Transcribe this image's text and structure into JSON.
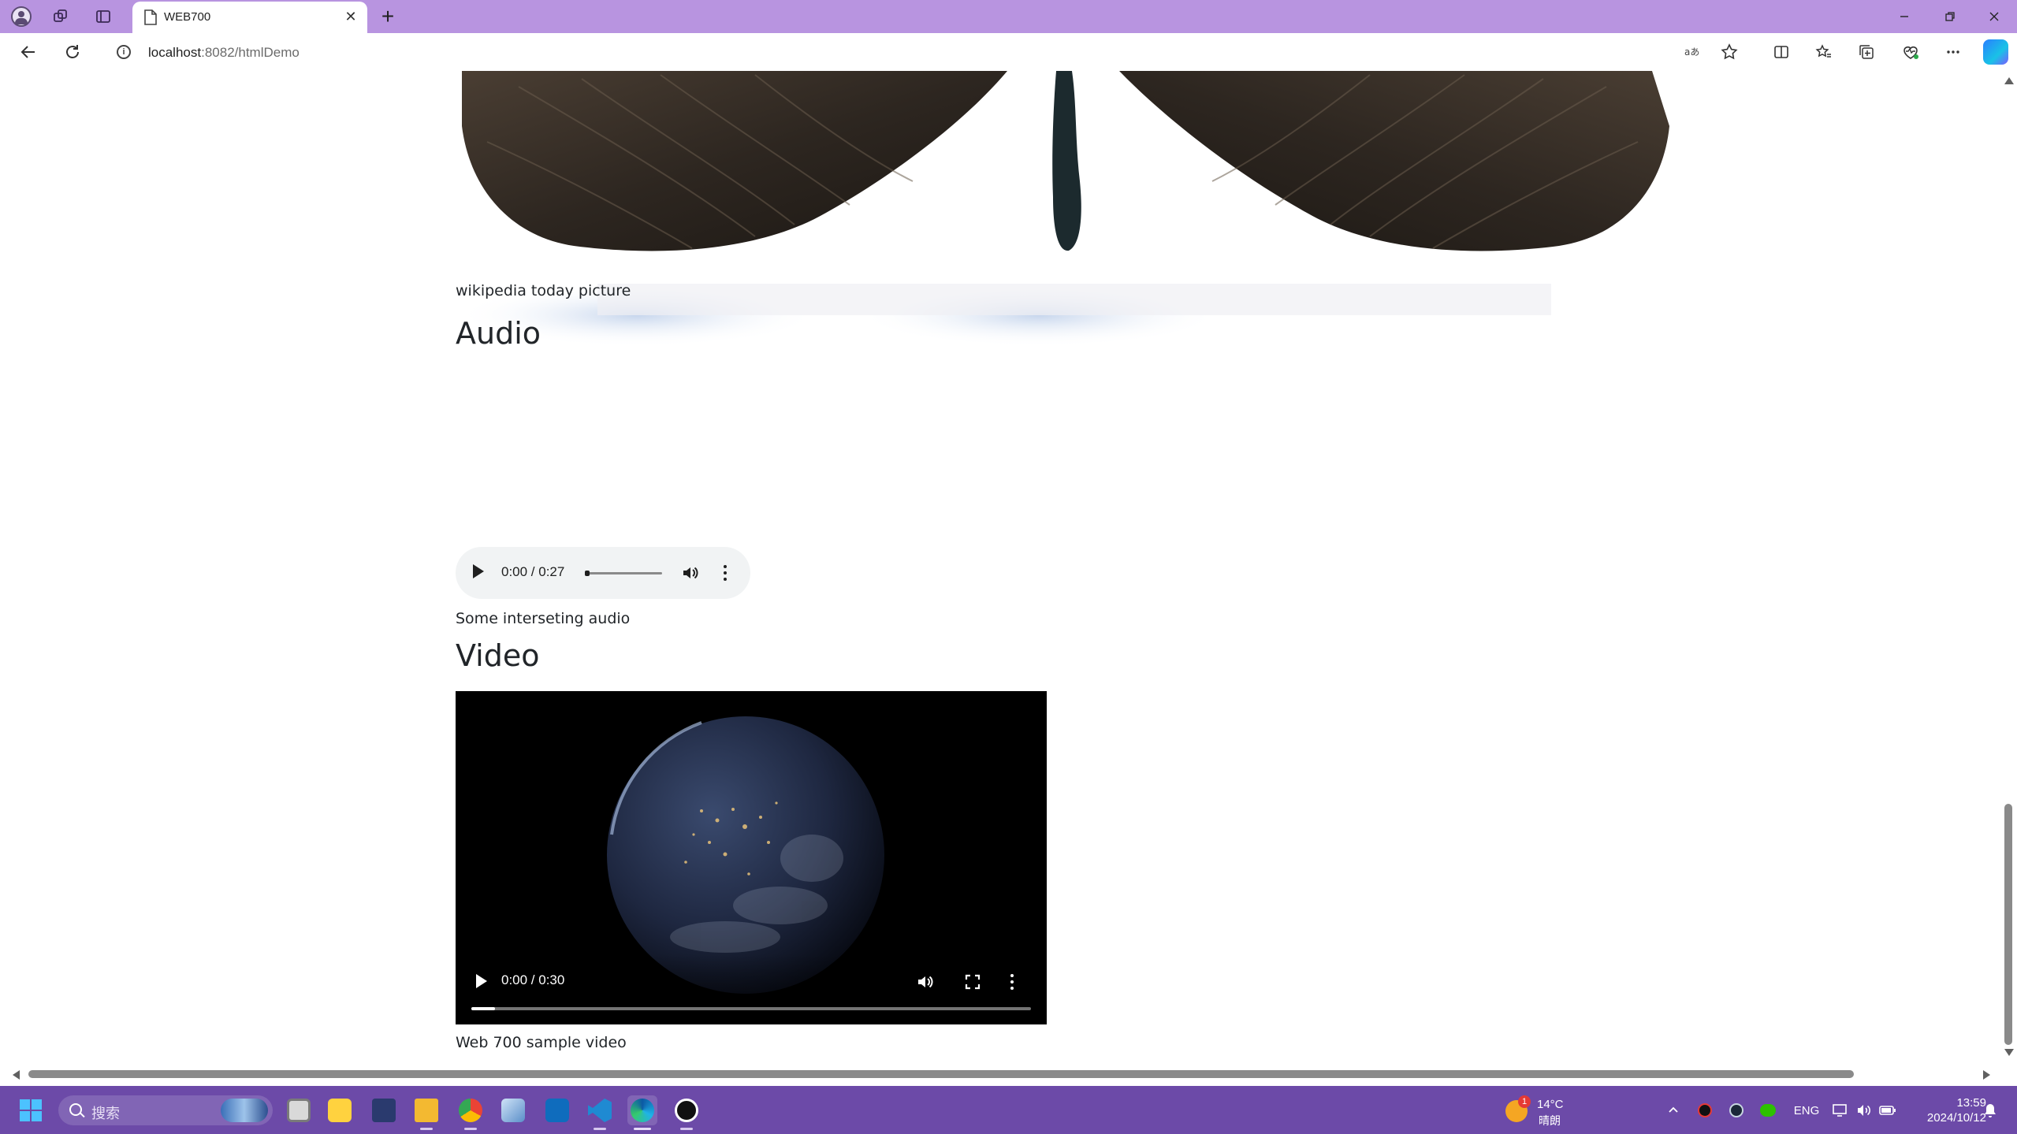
{
  "browser": {
    "tab": {
      "title": "WEB700",
      "close_glyph": "✕"
    },
    "new_tab_glyph": "+",
    "url": {
      "host": "localhost",
      "port_path": ":8082/htmlDemo"
    },
    "icons": [
      "profile-icon",
      "workspaces-icon",
      "tab-actions-icon",
      "back-icon",
      "reload-icon",
      "info-icon",
      "read-aloud-icon",
      "favorite-icon",
      "split-screen-icon",
      "favorites-icon",
      "collections-icon",
      "browser-essentials-icon",
      "more-icon",
      "copilot-icon"
    ]
  },
  "page": {
    "image_caption": "wikipedia today picture",
    "audio_heading": "Audio",
    "audio": {
      "time": "0:00 / 0:27",
      "progress": 0
    },
    "audio_caption": "Some interseting audio",
    "video_heading": "Video",
    "video": {
      "time": "0:00 / 0:30",
      "progress": 0
    },
    "video_caption": "Web 700 sample video"
  },
  "taskbar": {
    "search_placeholder": "搜索",
    "apps": [
      "file-explorer-icon",
      "sticky-notes-icon",
      "store-icon",
      "folder-icon",
      "chrome-icon",
      "photos-icon",
      "outlook-icon",
      "vscode-icon",
      "edge-icon",
      "qq-icon"
    ],
    "weather": {
      "badge": "1",
      "temp": "14°C",
      "condition": "晴朗"
    },
    "tray": {
      "lang": "ENG"
    },
    "clock": {
      "time": "13:59",
      "date": "2024/10/12"
    }
  },
  "colors": {
    "titlebar": "#b894e0",
    "taskbar": "#6c4aa8",
    "accent": "#0078d4"
  }
}
